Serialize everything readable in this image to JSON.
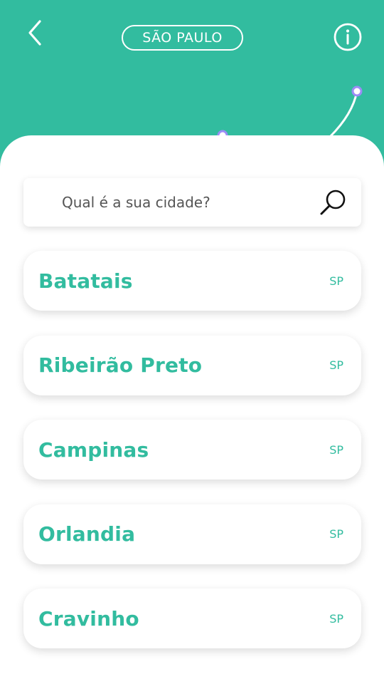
{
  "header": {
    "state_label": "SÃO PAULO",
    "background_color": "#32BC9F",
    "back_icon": "chevron-left-icon",
    "info_icon": "info-icon"
  },
  "search": {
    "placeholder": "Qual é a sua cidade?",
    "value": "",
    "icon": "search-icon"
  },
  "cities": [
    {
      "name": "Batatais",
      "state": "SP"
    },
    {
      "name": "Ribeirão Preto",
      "state": "SP"
    },
    {
      "name": "Campinas",
      "state": "SP"
    },
    {
      "name": "Orlandia",
      "state": "SP"
    },
    {
      "name": "Cravinho",
      "state": "SP"
    }
  ],
  "colors": {
    "accent": "#32BC9F",
    "marker": "#9B8CF5",
    "card": "#FFFFFF"
  }
}
